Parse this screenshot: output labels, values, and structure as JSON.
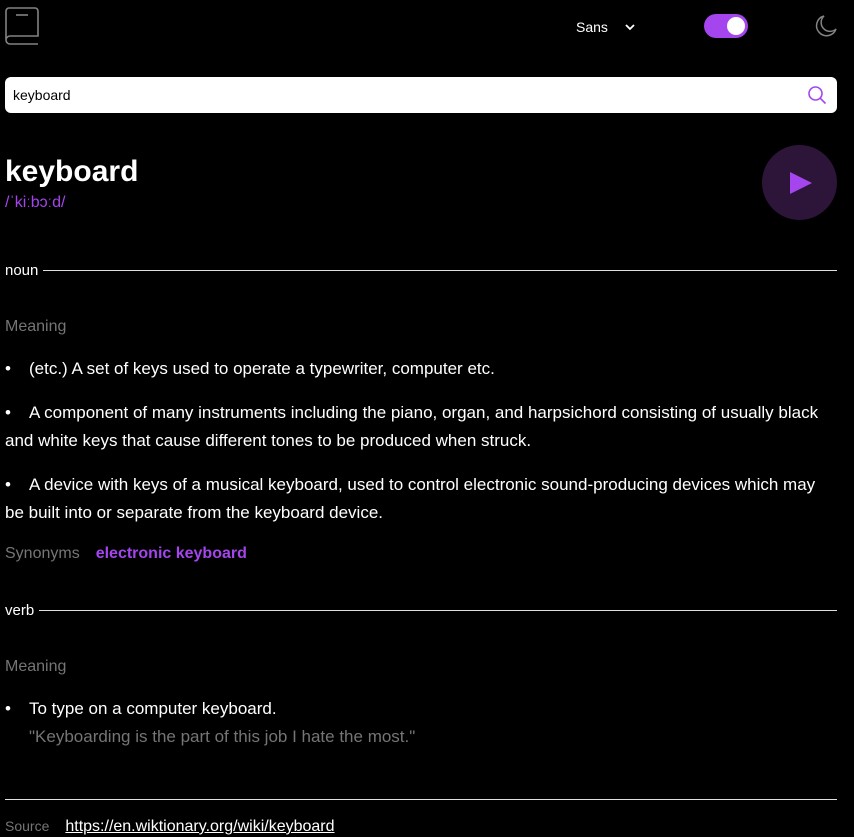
{
  "header": {
    "logo_icon": "book-icon",
    "font_selector": {
      "selected": "Sans",
      "icon": "chevron-down-icon"
    },
    "theme_toggle": {
      "state": "on"
    },
    "theme_icon": "moon-icon"
  },
  "search": {
    "value": "keyboard",
    "icon": "search-icon"
  },
  "entry": {
    "word": "keyboard",
    "phonetic": "/ˈkiːbɔːd/",
    "play_icon": "play-icon"
  },
  "meanings": [
    {
      "part_of_speech": "noun",
      "heading": "Meaning",
      "definitions": [
        {
          "bullet": "•",
          "text": "(etc.) A set of keys used to operate a typewriter, computer etc."
        },
        {
          "bullet": "•",
          "text": "A component of many instruments including the piano, organ, and harpsichord consisting of usually black and white keys that cause different tones to be produced when struck."
        },
        {
          "bullet": "•",
          "text": "A device with keys of a musical keyboard, used to control electronic sound-producing devices which may be built into or separate from the keyboard device."
        }
      ],
      "synonyms_label": "Synonyms",
      "synonyms": [
        "electronic keyboard"
      ]
    },
    {
      "part_of_speech": "verb",
      "heading": "Meaning",
      "definitions": [
        {
          "bullet": "•",
          "text": "To type on a computer keyboard.",
          "example": "\"Keyboarding is the part of this job I hate the most.\""
        }
      ]
    }
  ],
  "source": {
    "label": "Source",
    "url": "https://en.wiktionary.org/wiki/keyboard"
  },
  "colors": {
    "accent": "#a445ed",
    "background": "#000000",
    "muted": "#757575"
  }
}
